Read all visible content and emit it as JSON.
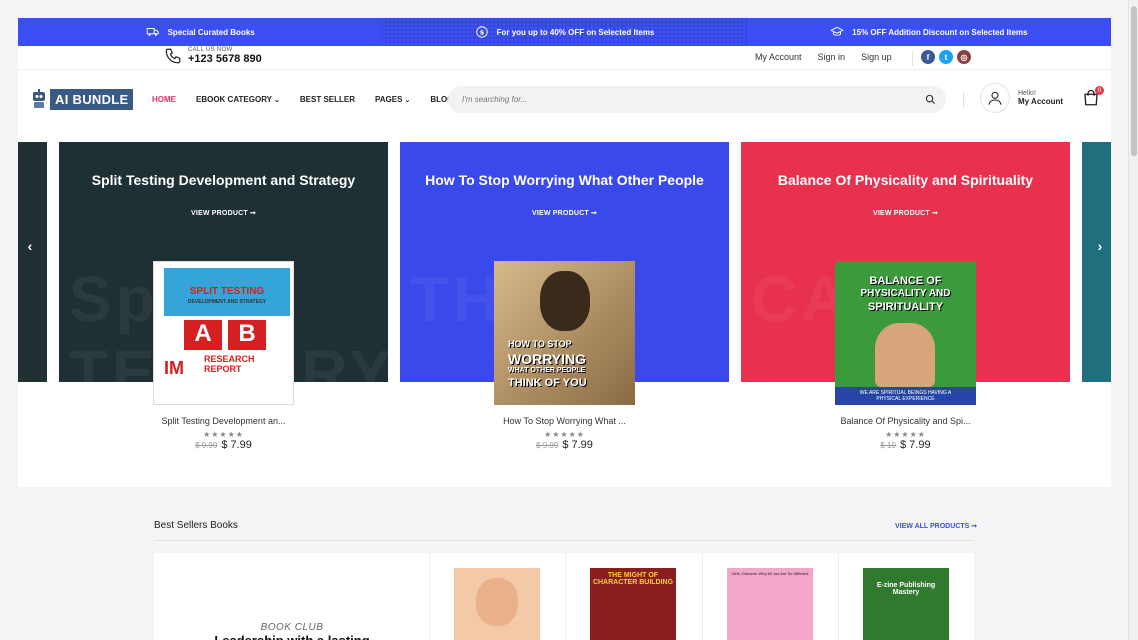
{
  "promo": {
    "left": "Special Curated Books",
    "middle": "For you up to 40% OFF on Selected Items",
    "right": "15% OFF Addition Discount on Selected Items"
  },
  "topbar": {
    "call_label": "CALL US NOW",
    "phone": "+123 5678 890",
    "links": [
      "My Account",
      "Sign in",
      "Sign up"
    ],
    "socials": [
      {
        "icon": "facebook-icon",
        "glyph": "f",
        "color": "#3b5998"
      },
      {
        "icon": "twitter-icon",
        "glyph": "t",
        "color": "#1da1f2"
      },
      {
        "icon": "instagram-icon",
        "glyph": "◎",
        "color": "#8a3f3f"
      }
    ]
  },
  "nav": {
    "logo_text": "AI BUNDLE",
    "menu": [
      "HOME",
      "EBOOK CATEGORY",
      "BEST SELLER",
      "PAGES",
      "BLOG"
    ],
    "search_placeholder": "I'm searching for...",
    "hello": "Hello!",
    "my_account": "My Account",
    "cart_count": "0"
  },
  "carousel": {
    "prev": "‹",
    "next": "›",
    "view_label": "VIEW PRODUCT ➞",
    "slides": [
      {
        "title": "Split Testing Development and Strategy",
        "name": "Split Testing Development an...",
        "stars": "★★★★★",
        "old_price": "$ 9.99",
        "price": "$ 7.99",
        "color": "#1f3035",
        "ghost": "Split TESTORY",
        "cover_lines": [
          "SPLIT TESTING",
          "DEVELOPMENT AND STRATEGY",
          "A",
          "B",
          "IM",
          "RESEARCH REPORT"
        ]
      },
      {
        "title": "How To Stop Worrying What Other People",
        "name": "How To Stop Worrying What ...",
        "stars": "★★★★★",
        "old_price": "$ 9.99",
        "price": "$ 7.99",
        "color": "#3a49ea",
        "ghost": "THINK",
        "cover_lines": [
          "HOW TO STOP",
          "WORRYING",
          "WHAT OTHER PEOPLE",
          "THINK OF YOU"
        ]
      },
      {
        "title": "Balance Of Physicality and Spirituality",
        "name": "Balance Of Physicality and Spi...",
        "stars": "★★★★★",
        "old_price": "$ 10",
        "price": "$ 7.99",
        "color": "#e8314f",
        "ghost": "CALL",
        "cover_lines": [
          "BALANCE OF",
          "PHYSICALITY AND",
          "SPIRITUALITY",
          "WE ARE SPIRITUAL BEINGS HAVING A PHYSICAL EXPERIENCE"
        ]
      }
    ]
  },
  "bestsellers": {
    "heading": "Best Sellers Books",
    "view_all": "VIEW ALL PRODUCTS ➞",
    "club_label": "BOOK CLUB",
    "club_title": "Leadership with a lasting",
    "books": [
      {
        "label": "",
        "color": "#f3c9a8"
      },
      {
        "label": "THE MIGHT OF CHARACTER BUILDING",
        "color": "#8a1d1d"
      },
      {
        "label": "Girls, Discover Why All Jus Are So Different",
        "color": "#f2a6c9"
      },
      {
        "label": "E-zine Publishing Mastery",
        "color": "#2f7a2f"
      }
    ]
  }
}
